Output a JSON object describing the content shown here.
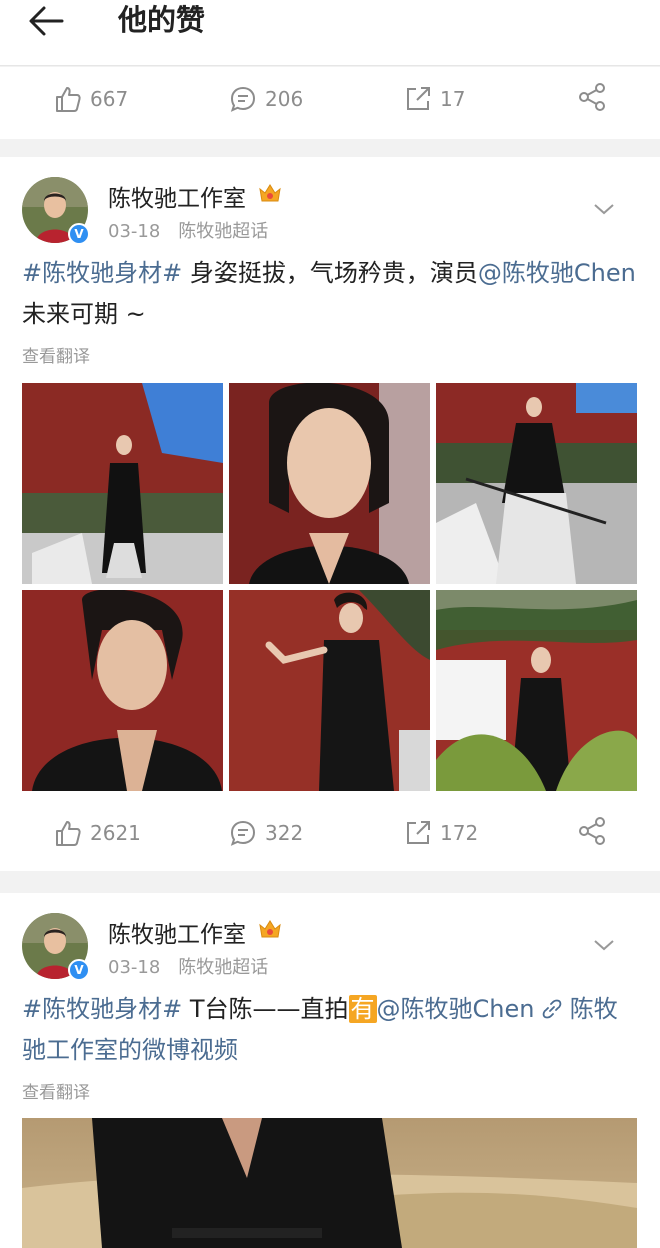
{
  "header": {
    "title": "他的赞"
  },
  "post0": {
    "likes": "667",
    "comments": "206",
    "reposts": "17"
  },
  "post1": {
    "author": "陈牧驰工作室",
    "date": "03-18",
    "source": "陈牧驰超话",
    "hashtag": "#陈牧驰身材#",
    "text1": " 身姿挺拔，气场矜贵，演员",
    "mention": "@陈牧驰Chen",
    "text2": " 未来可期 ~",
    "translate": "查看翻译",
    "likes": "2621",
    "comments": "322",
    "reposts": "172"
  },
  "post2": {
    "author": "陈牧驰工作室",
    "date": "03-18",
    "source": "陈牧驰超话",
    "hashtag": "#陈牧驰身材#",
    "text1": " T台陈——直拍",
    "you_tag": "有",
    "mention": "@陈牧驰Chen",
    "link_text": "陈牧驰工作室的微博视频",
    "translate": "查看翻译"
  },
  "colors": {
    "link_blue": "#4b6c91",
    "verified_blue": "#2f8ff2",
    "accent_orange": "#f5a623"
  }
}
